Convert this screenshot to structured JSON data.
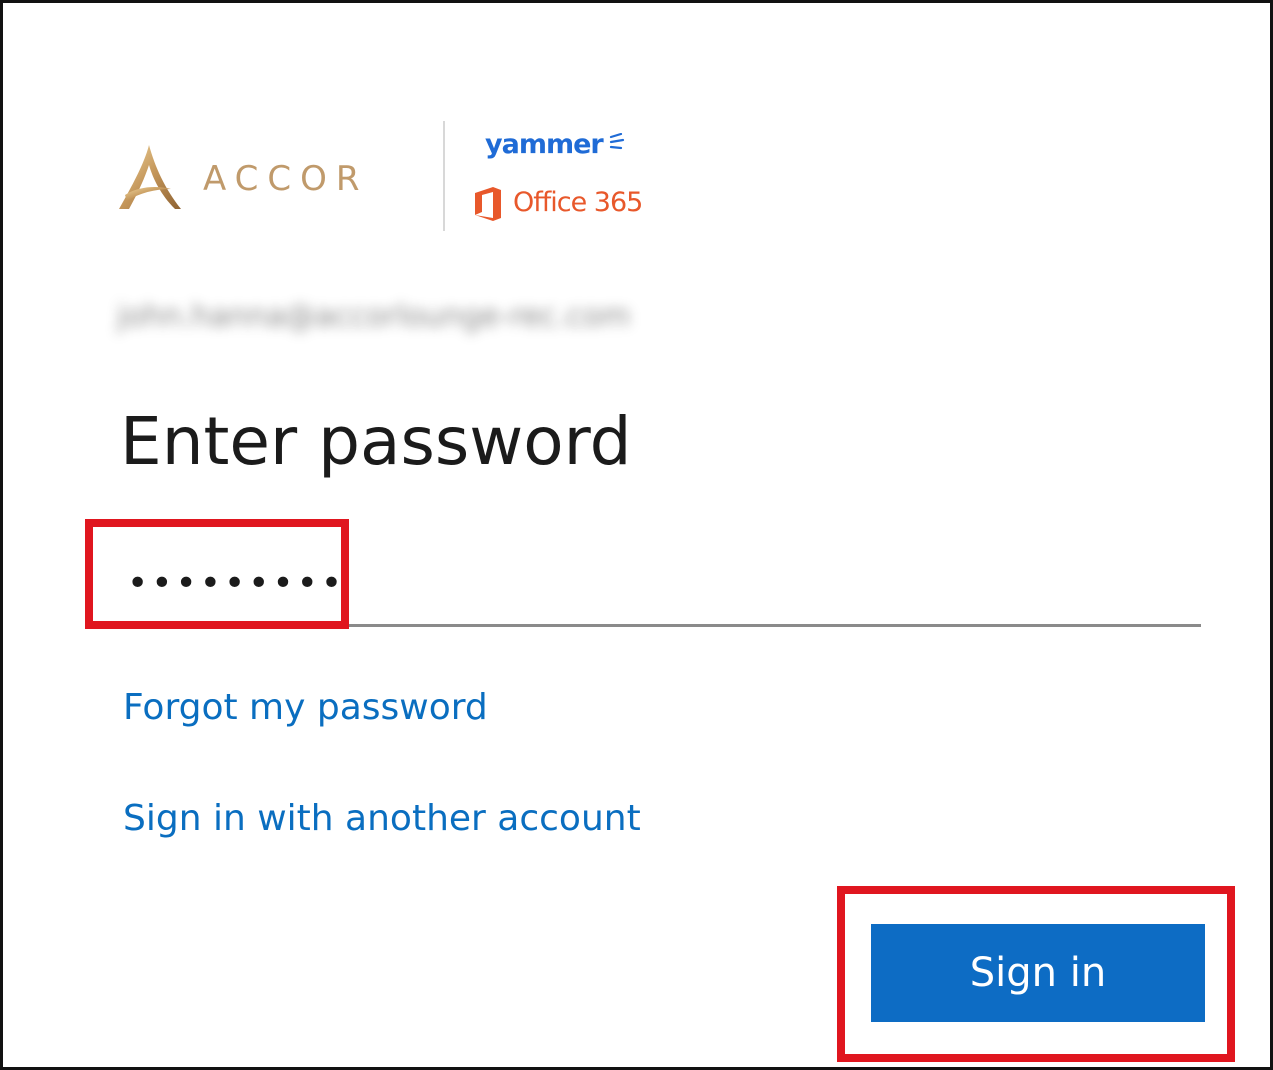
{
  "brand": {
    "accor_word": "ACCOR",
    "yammer_word": "yammer",
    "office_word": "Office 365",
    "colors": {
      "accor_gold": "#c09a6b",
      "yammer_blue": "#1f6bd6",
      "office_orange": "#e8582b"
    }
  },
  "account": {
    "email": "john.hanna@accorlounge-rec.com"
  },
  "form": {
    "title": "Enter password",
    "password_value": "•••••••••",
    "forgot_link": "Forgot my password",
    "another_account_link": "Sign in with another account",
    "submit_label": "Sign in"
  },
  "colors": {
    "accent": "#0d6cc4",
    "link": "#0a6ec0",
    "highlight": "#e0161f"
  }
}
